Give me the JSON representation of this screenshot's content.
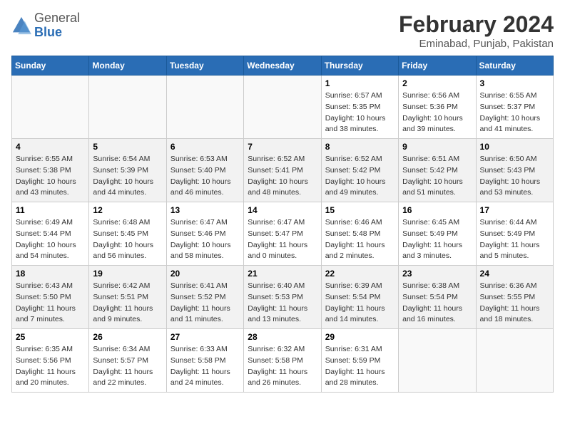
{
  "header": {
    "logo_general": "General",
    "logo_blue": "Blue",
    "month_title": "February 2024",
    "location": "Eminabad, Punjab, Pakistan"
  },
  "days_of_week": [
    "Sunday",
    "Monday",
    "Tuesday",
    "Wednesday",
    "Thursday",
    "Friday",
    "Saturday"
  ],
  "weeks": [
    [
      {
        "day": "",
        "sunrise": "",
        "sunset": "",
        "daylight": "",
        "empty": true
      },
      {
        "day": "",
        "sunrise": "",
        "sunset": "",
        "daylight": "",
        "empty": true
      },
      {
        "day": "",
        "sunrise": "",
        "sunset": "",
        "daylight": "",
        "empty": true
      },
      {
        "day": "",
        "sunrise": "",
        "sunset": "",
        "daylight": "",
        "empty": true
      },
      {
        "day": "1",
        "sunrise": "Sunrise: 6:57 AM",
        "sunset": "Sunset: 5:35 PM",
        "daylight": "Daylight: 10 hours and 38 minutes."
      },
      {
        "day": "2",
        "sunrise": "Sunrise: 6:56 AM",
        "sunset": "Sunset: 5:36 PM",
        "daylight": "Daylight: 10 hours and 39 minutes."
      },
      {
        "day": "3",
        "sunrise": "Sunrise: 6:55 AM",
        "sunset": "Sunset: 5:37 PM",
        "daylight": "Daylight: 10 hours and 41 minutes."
      }
    ],
    [
      {
        "day": "4",
        "sunrise": "Sunrise: 6:55 AM",
        "sunset": "Sunset: 5:38 PM",
        "daylight": "Daylight: 10 hours and 43 minutes."
      },
      {
        "day": "5",
        "sunrise": "Sunrise: 6:54 AM",
        "sunset": "Sunset: 5:39 PM",
        "daylight": "Daylight: 10 hours and 44 minutes."
      },
      {
        "day": "6",
        "sunrise": "Sunrise: 6:53 AM",
        "sunset": "Sunset: 5:40 PM",
        "daylight": "Daylight: 10 hours and 46 minutes."
      },
      {
        "day": "7",
        "sunrise": "Sunrise: 6:52 AM",
        "sunset": "Sunset: 5:41 PM",
        "daylight": "Daylight: 10 hours and 48 minutes."
      },
      {
        "day": "8",
        "sunrise": "Sunrise: 6:52 AM",
        "sunset": "Sunset: 5:42 PM",
        "daylight": "Daylight: 10 hours and 49 minutes."
      },
      {
        "day": "9",
        "sunrise": "Sunrise: 6:51 AM",
        "sunset": "Sunset: 5:42 PM",
        "daylight": "Daylight: 10 hours and 51 minutes."
      },
      {
        "day": "10",
        "sunrise": "Sunrise: 6:50 AM",
        "sunset": "Sunset: 5:43 PM",
        "daylight": "Daylight: 10 hours and 53 minutes."
      }
    ],
    [
      {
        "day": "11",
        "sunrise": "Sunrise: 6:49 AM",
        "sunset": "Sunset: 5:44 PM",
        "daylight": "Daylight: 10 hours and 54 minutes."
      },
      {
        "day": "12",
        "sunrise": "Sunrise: 6:48 AM",
        "sunset": "Sunset: 5:45 PM",
        "daylight": "Daylight: 10 hours and 56 minutes."
      },
      {
        "day": "13",
        "sunrise": "Sunrise: 6:47 AM",
        "sunset": "Sunset: 5:46 PM",
        "daylight": "Daylight: 10 hours and 58 minutes."
      },
      {
        "day": "14",
        "sunrise": "Sunrise: 6:47 AM",
        "sunset": "Sunset: 5:47 PM",
        "daylight": "Daylight: 11 hours and 0 minutes."
      },
      {
        "day": "15",
        "sunrise": "Sunrise: 6:46 AM",
        "sunset": "Sunset: 5:48 PM",
        "daylight": "Daylight: 11 hours and 2 minutes."
      },
      {
        "day": "16",
        "sunrise": "Sunrise: 6:45 AM",
        "sunset": "Sunset: 5:49 PM",
        "daylight": "Daylight: 11 hours and 3 minutes."
      },
      {
        "day": "17",
        "sunrise": "Sunrise: 6:44 AM",
        "sunset": "Sunset: 5:49 PM",
        "daylight": "Daylight: 11 hours and 5 minutes."
      }
    ],
    [
      {
        "day": "18",
        "sunrise": "Sunrise: 6:43 AM",
        "sunset": "Sunset: 5:50 PM",
        "daylight": "Daylight: 11 hours and 7 minutes."
      },
      {
        "day": "19",
        "sunrise": "Sunrise: 6:42 AM",
        "sunset": "Sunset: 5:51 PM",
        "daylight": "Daylight: 11 hours and 9 minutes."
      },
      {
        "day": "20",
        "sunrise": "Sunrise: 6:41 AM",
        "sunset": "Sunset: 5:52 PM",
        "daylight": "Daylight: 11 hours and 11 minutes."
      },
      {
        "day": "21",
        "sunrise": "Sunrise: 6:40 AM",
        "sunset": "Sunset: 5:53 PM",
        "daylight": "Daylight: 11 hours and 13 minutes."
      },
      {
        "day": "22",
        "sunrise": "Sunrise: 6:39 AM",
        "sunset": "Sunset: 5:54 PM",
        "daylight": "Daylight: 11 hours and 14 minutes."
      },
      {
        "day": "23",
        "sunrise": "Sunrise: 6:38 AM",
        "sunset": "Sunset: 5:54 PM",
        "daylight": "Daylight: 11 hours and 16 minutes."
      },
      {
        "day": "24",
        "sunrise": "Sunrise: 6:36 AM",
        "sunset": "Sunset: 5:55 PM",
        "daylight": "Daylight: 11 hours and 18 minutes."
      }
    ],
    [
      {
        "day": "25",
        "sunrise": "Sunrise: 6:35 AM",
        "sunset": "Sunset: 5:56 PM",
        "daylight": "Daylight: 11 hours and 20 minutes."
      },
      {
        "day": "26",
        "sunrise": "Sunrise: 6:34 AM",
        "sunset": "Sunset: 5:57 PM",
        "daylight": "Daylight: 11 hours and 22 minutes."
      },
      {
        "day": "27",
        "sunrise": "Sunrise: 6:33 AM",
        "sunset": "Sunset: 5:58 PM",
        "daylight": "Daylight: 11 hours and 24 minutes."
      },
      {
        "day": "28",
        "sunrise": "Sunrise: 6:32 AM",
        "sunset": "Sunset: 5:58 PM",
        "daylight": "Daylight: 11 hours and 26 minutes."
      },
      {
        "day": "29",
        "sunrise": "Sunrise: 6:31 AM",
        "sunset": "Sunset: 5:59 PM",
        "daylight": "Daylight: 11 hours and 28 minutes."
      },
      {
        "day": "",
        "sunrise": "",
        "sunset": "",
        "daylight": "",
        "empty": true
      },
      {
        "day": "",
        "sunrise": "",
        "sunset": "",
        "daylight": "",
        "empty": true
      }
    ]
  ]
}
